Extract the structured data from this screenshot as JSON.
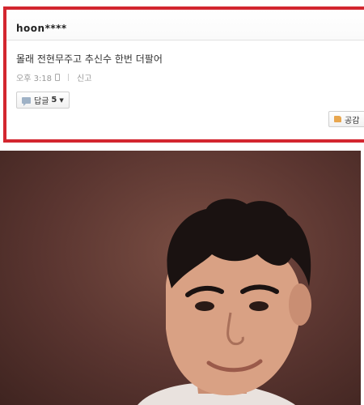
{
  "comment": {
    "username": "hoon****",
    "text": "몰래 전현무주고 추신수 한번 더팔어",
    "time": "오후 3:18",
    "report_label": "신고",
    "reply_label": "답글",
    "reply_count": "5",
    "like_label": "공감"
  },
  "colors": {
    "highlight_border": "#d3262f",
    "photo_background": "#5a3530"
  },
  "icons": [
    "mobile-icon",
    "speech-bubble-icon",
    "thumbs-up-icon",
    "caret-down-icon"
  ]
}
